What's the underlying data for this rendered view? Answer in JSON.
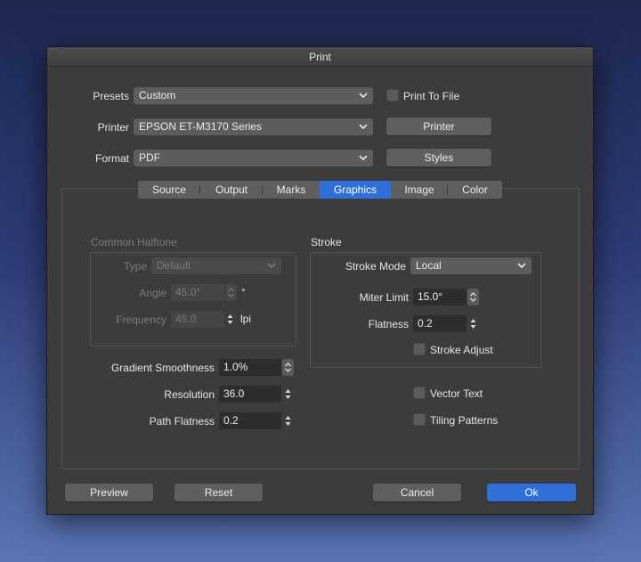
{
  "window": {
    "title": "Print"
  },
  "header": {
    "presets": {
      "label": "Presets",
      "value": "Custom"
    },
    "printer": {
      "label": "Printer",
      "value": "EPSON ET-M3170 Series"
    },
    "format": {
      "label": "Format",
      "value": "PDF"
    },
    "print_to_file": {
      "label": "Print To File",
      "checked": false
    },
    "printer_button": "Printer",
    "styles_button": "Styles"
  },
  "tabs": [
    {
      "label": "Source",
      "active": false
    },
    {
      "label": "Output",
      "active": false
    },
    {
      "label": "Marks",
      "active": false
    },
    {
      "label": "Graphics",
      "active": true
    },
    {
      "label": "Image",
      "active": false
    },
    {
      "label": "Color",
      "active": false
    }
  ],
  "halftone": {
    "title": "Common Halftone",
    "type": {
      "label": "Type",
      "value": "Default"
    },
    "angle": {
      "label": "Angle",
      "value": "45.0°",
      "unit": "°"
    },
    "frequency": {
      "label": "Frequency",
      "value": "45.0",
      "unit": "lpi"
    }
  },
  "gradient": {
    "smoothness": {
      "label": "Gradient Smoothness",
      "value": "1.0%"
    },
    "resolution": {
      "label": "Resolution",
      "value": "36.0"
    },
    "path_flatness": {
      "label": "Path Flatness",
      "value": "0.2"
    }
  },
  "stroke": {
    "title": "Stroke",
    "mode": {
      "label": "Stroke Mode",
      "value": "Local"
    },
    "miter_limit": {
      "label": "Miter Limit",
      "value": "15.0°"
    },
    "flatness": {
      "label": "Flatness",
      "value": "0.2"
    },
    "adjust": {
      "label": "Stroke Adjust",
      "checked": false
    }
  },
  "options": {
    "vector_text": {
      "label": "Vector Text",
      "checked": false
    },
    "tiling_patterns": {
      "label": "Tiling Patterns",
      "checked": false
    }
  },
  "footer": {
    "preview": "Preview",
    "reset": "Reset",
    "cancel": "Cancel",
    "ok": "Ok"
  },
  "colors": {
    "accent": "#2f6fd9",
    "dialog_bg": "#3c3c3c"
  }
}
